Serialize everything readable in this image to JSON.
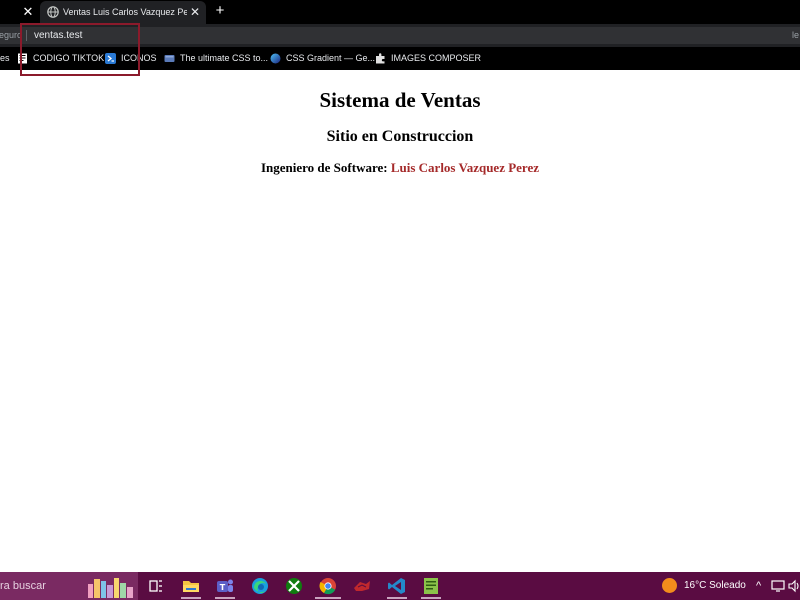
{
  "browser": {
    "active_tab_title": "Ventas Luis Carlos Vazquez Perez",
    "close_glyph": "✕",
    "new_tab_glyph": "+",
    "security_label": "eguro",
    "url": "ventas.test",
    "right_truncated": "le"
  },
  "bookmarks": {
    "first_partial": "es",
    "items": [
      {
        "label": "CODIGO TIKTOK",
        "icon": "tiktok-icon"
      },
      {
        "label": "ICONOS",
        "icon": "powershell-icon"
      },
      {
        "label": "The ultimate CSS to...",
        "icon": "page-icon"
      },
      {
        "label": "CSS Gradient — Ge...",
        "icon": "gradient-icon"
      },
      {
        "label": "IMAGES COMPOSER",
        "icon": "puzzle-icon"
      }
    ]
  },
  "page": {
    "title": "Sistema de Ventas",
    "subtitle": "Sitio en Construccion",
    "role_label": "Ingeniero de Software: ",
    "author": "Luis Carlos Vazquez Perez"
  },
  "taskbar": {
    "search_text": "ra buscar",
    "apps": [
      "task-view-icon",
      "file-explorer-icon",
      "teams-icon",
      "edge-icon",
      "xbox-icon",
      "chrome-icon",
      "app-icon",
      "vscode-icon",
      "notepad-icon"
    ],
    "weather": "16°C  Soleado",
    "tray_chevron": "^"
  },
  "colors": {
    "author": "#a52a2a",
    "highlight": "#8b1a2b",
    "taskbar": "#5a0c42"
  }
}
